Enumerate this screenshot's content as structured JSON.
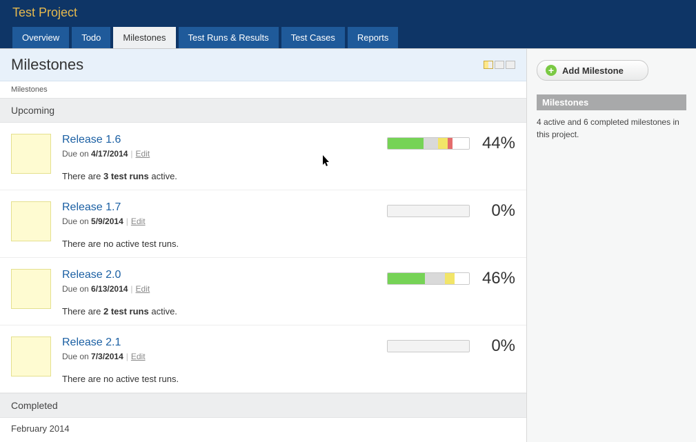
{
  "header": {
    "project_title": "Test Project",
    "tabs": [
      {
        "label": "Overview",
        "active": false
      },
      {
        "label": "Todo",
        "active": false
      },
      {
        "label": "Milestones",
        "active": true
      },
      {
        "label": "Test Runs & Results",
        "active": false
      },
      {
        "label": "Test Cases",
        "active": false
      },
      {
        "label": "Reports",
        "active": false
      }
    ]
  },
  "page": {
    "title": "Milestones",
    "breadcrumb": "Milestones",
    "sections": {
      "upcoming_label": "Upcoming",
      "completed_label": "Completed"
    }
  },
  "milestones": [
    {
      "title": "Release 1.6",
      "due_prefix": "Due on ",
      "due_date": "4/17/2014",
      "edit_label": "Edit",
      "runs_html": {
        "prefix": "There are ",
        "bold": "3 test runs",
        "suffix": " active."
      },
      "pct": "44%",
      "segs": [
        {
          "color": "#76d356",
          "w": 44
        },
        {
          "color": "#d9d9d9",
          "w": 18
        },
        {
          "color": "#f2e568",
          "w": 12
        },
        {
          "color": "#e46c6c",
          "w": 6
        },
        {
          "color": "#ffffff",
          "w": 20
        }
      ]
    },
    {
      "title": "Release 1.7",
      "due_prefix": "Due on ",
      "due_date": "5/9/2014",
      "edit_label": "Edit",
      "runs_html": {
        "prefix": "There are no active test runs.",
        "bold": "",
        "suffix": ""
      },
      "pct": "0%",
      "segs": [
        {
          "color": "#f3f3f3",
          "w": 100
        }
      ]
    },
    {
      "title": "Release 2.0",
      "due_prefix": "Due on ",
      "due_date": "6/13/2014",
      "edit_label": "Edit",
      "runs_html": {
        "prefix": "There are ",
        "bold": "2 test runs",
        "suffix": " active."
      },
      "pct": "46%",
      "segs": [
        {
          "color": "#76d356",
          "w": 46
        },
        {
          "color": "#d9d9d9",
          "w": 24
        },
        {
          "color": "#f2e568",
          "w": 12
        },
        {
          "color": "#ffffff",
          "w": 18
        }
      ]
    },
    {
      "title": "Release 2.1",
      "due_prefix": "Due on ",
      "due_date": "7/3/2014",
      "edit_label": "Edit",
      "runs_html": {
        "prefix": "There are no active test runs.",
        "bold": "",
        "suffix": ""
      },
      "pct": "0%",
      "segs": [
        {
          "color": "#f3f3f3",
          "w": 100
        }
      ]
    }
  ],
  "completed_first_group": "February 2014",
  "sidebar": {
    "add_label": "Add Milestone",
    "section_label": "Milestones",
    "summary": "4 active and 6 completed milestones in this project."
  }
}
